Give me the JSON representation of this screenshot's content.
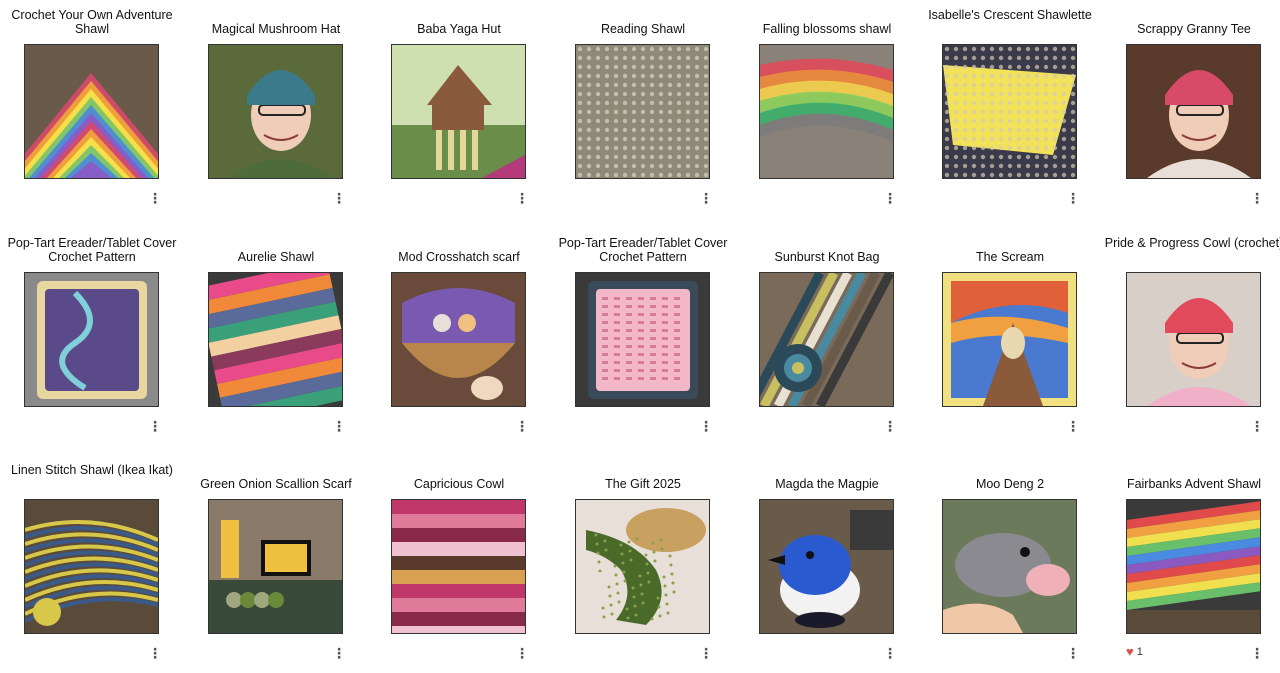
{
  "projects": [
    {
      "title": "Crochet Your Own Adventure Shawl",
      "colors": [
        "#d44a6a",
        "#f0a23a",
        "#f6e34a",
        "#7cc36b",
        "#4c8bd6",
        "#8a5bc6"
      ],
      "style": "chevron",
      "likes": ""
    },
    {
      "title": "Magical Mushroom Hat",
      "colors": [
        "#3b7a8a",
        "#d2c05a",
        "#8c3e3e",
        "#f3d7c5",
        "#4e6b3a",
        "#e8e2da"
      ],
      "style": "portrait",
      "likes": ""
    },
    {
      "title": "Baba Yaga Hut",
      "colors": [
        "#6a8d4a",
        "#8a5a3c",
        "#e5d79a",
        "#b43a7a",
        "#3c3c5a",
        "#cfe0b0"
      ],
      "style": "hut",
      "likes": ""
    },
    {
      "title": "Reading Shawl",
      "colors": [
        "#8e8a78",
        "#b7b2a0",
        "#6b6657",
        "#d9d5c8",
        "#f2c94a",
        "#5a4c42"
      ],
      "style": "mesh",
      "likes": ""
    },
    {
      "title": "Falling blossoms shawl",
      "colors": [
        "#e04a5a",
        "#f08a3a",
        "#f6d24a",
        "#8ed05a",
        "#3ab06a",
        "#7b7b7b"
      ],
      "style": "gradient",
      "likes": ""
    },
    {
      "title": "Isabelle's Crescent Shawlette",
      "colors": [
        "#f2e25a",
        "#e8d240",
        "#8c7a5a",
        "#3a3a4a",
        "#d6c9b0",
        "#f7f1b0"
      ],
      "style": "mesh-yellow",
      "likes": ""
    },
    {
      "title": "Scrappy Granny Tee",
      "colors": [
        "#d84a6a",
        "#f0c0a0",
        "#7a4a3a",
        "#2a2a3a",
        "#e8e0d8",
        "#5a3a2a"
      ],
      "style": "portrait2",
      "likes": ""
    },
    {
      "title": "Pop-Tart Ereader/Tablet Cover Crochet Pattern",
      "colors": [
        "#5a4a8a",
        "#7fd0d8",
        "#e8d7a0",
        "#3a3a6a",
        "#f2e6b8",
        "#4a6a8a"
      ],
      "style": "poptart",
      "likes": ""
    },
    {
      "title": "Aurelie Shawl",
      "colors": [
        "#e84a8a",
        "#f08a3a",
        "#5a6a9a",
        "#3aa07a",
        "#f2d0a0",
        "#8a3a5a"
      ],
      "style": "stripes",
      "likes": ""
    },
    {
      "title": "Mod Crosshatch scarf",
      "colors": [
        "#7a5ab0",
        "#b8864a",
        "#d8a060",
        "#e8e0d8",
        "#4a3a7a",
        "#f0c080"
      ],
      "style": "bowl",
      "likes": ""
    },
    {
      "title": "Pop-Tart Ereader/Tablet Cover Crochet Pattern",
      "colors": [
        "#f2b8c8",
        "#e8dcc0",
        "#3a4a5a",
        "#7aa0c0",
        "#d87a9a",
        "#6a7a8a"
      ],
      "style": "pinkcover",
      "likes": ""
    },
    {
      "title": "Sunburst Knot Bag",
      "colors": [
        "#2a4a5a",
        "#c8c060",
        "#e8e0d0",
        "#4a8aa0",
        "#6a5a4a",
        "#3a3a3a"
      ],
      "style": "bag",
      "likes": ""
    },
    {
      "title": "The Scream",
      "colors": [
        "#f0e080",
        "#e0603a",
        "#4a7ad0",
        "#8a5a3a",
        "#2a3a6a",
        "#f0a040"
      ],
      "style": "scream",
      "likes": ""
    },
    {
      "title": "Pride & Progress Cowl (crochet)",
      "colors": [
        "#e04a5a",
        "#f0c04a",
        "#6ad07a",
        "#4a9ae0",
        "#f0b0c8",
        "#5a3a2a"
      ],
      "style": "portrait3",
      "likes": ""
    },
    {
      "title": "Linen Stitch Shawl (Ikea Ikat)",
      "colors": [
        "#3a5a8a",
        "#d8c84a",
        "#8a8a7a",
        "#5a4a3a",
        "#c8c0a8",
        "#2a3a5a"
      ],
      "style": "linen",
      "likes": ""
    },
    {
      "title": "Green Onion Scallion Scarf",
      "colors": [
        "#6a8a3a",
        "#e8d890",
        "#3a4a3a",
        "#f0c040",
        "#a0a880",
        "#2a2a2a"
      ],
      "style": "desk",
      "likes": ""
    },
    {
      "title": "Capricious Cowl",
      "colors": [
        "#c0386a",
        "#e07a9a",
        "#8a2a4a",
        "#f0c0d0",
        "#5a3a2a",
        "#d8a050"
      ],
      "style": "pinkstripes",
      "likes": ""
    },
    {
      "title": "The Gift 2025",
      "colors": [
        "#4a6a2a",
        "#8aa04a",
        "#c8a060",
        "#e8e0d8",
        "#2a3a1a",
        "#6a4a2a"
      ],
      "style": "gift",
      "likes": ""
    },
    {
      "title": "Magda the Magpie",
      "colors": [
        "#2a5ad0",
        "#f2f2f2",
        "#1a1a2a",
        "#d8b070",
        "#6a8ab0",
        "#3a3a3a"
      ],
      "style": "bird",
      "likes": ""
    },
    {
      "title": "Moo Deng 2",
      "colors": [
        "#8a8a90",
        "#f0b0b8",
        "#5a5a60",
        "#d8c8b8",
        "#3a3a40",
        "#b8b8c0"
      ],
      "style": "hippo",
      "likes": ""
    },
    {
      "title": "Fairbanks Advent Shawl",
      "colors": [
        "#e04a4a",
        "#f0a040",
        "#f0e050",
        "#6ac06a",
        "#4a8ae0",
        "#8a5ac0"
      ],
      "style": "rainbow",
      "likes": "1"
    }
  ],
  "menu_glyph": "⋮",
  "heart_glyph": "♥"
}
